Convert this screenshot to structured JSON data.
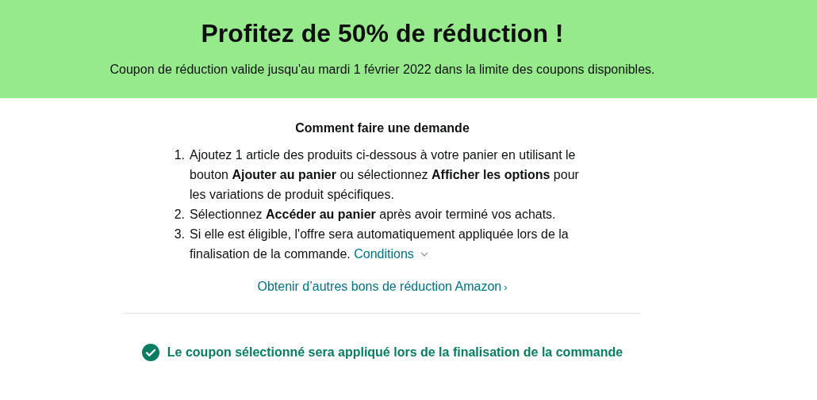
{
  "banner": {
    "title": "Profitez de 50% de réduction !",
    "subtitle": "Coupon de réduction valide jusqu'au mardi 1 février 2022 dans la limite des coupons disponibles."
  },
  "instructions": {
    "heading": "Comment faire une demande",
    "steps": [
      {
        "number": "1.",
        "text": "Ajoutez 1 article des produits ci-dessous à votre panier en utilisant le bouton **Ajouter au panier** ou sélectionnez **Afficher les options** pour les variations de produit spécifiques."
      },
      {
        "number": "2.",
        "text": "Sélectionnez **Accéder au panier** après avoir terminé vos achats."
      },
      {
        "number": "3.",
        "text": "Si elle est éligible, l'offre sera automatiquement appliquée lors de la finalisation de la commande.",
        "link": "Conditions"
      }
    ],
    "more_link": "Obtenir d’autres bons de réduction Amazon",
    "more_chevron": "›"
  },
  "status": {
    "selected": true,
    "message": "Le coupon sélectionné sera appliqué lors de la finalisation de la commande"
  }
}
